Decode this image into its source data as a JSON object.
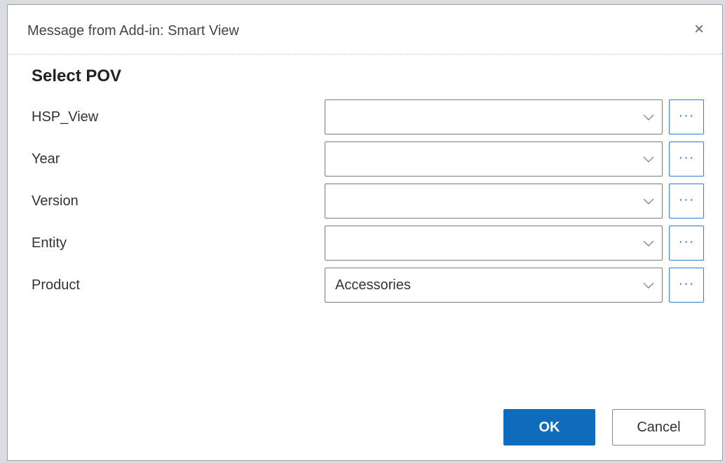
{
  "window": {
    "title": "Message from Add-in: Smart View",
    "close_glyph": "×"
  },
  "heading": "Select POV",
  "pov_rows": [
    {
      "label": "HSP_View",
      "value": "",
      "browse_label": "···"
    },
    {
      "label": "Year",
      "value": "",
      "browse_label": "···"
    },
    {
      "label": "Version",
      "value": "",
      "browse_label": "···"
    },
    {
      "label": "Entity",
      "value": "",
      "browse_label": "···"
    },
    {
      "label": "Product",
      "value": "Accessories",
      "browse_label": "···"
    }
  ],
  "buttons": {
    "ok": "OK",
    "cancel": "Cancel"
  },
  "icons": {
    "close": "close-icon",
    "dropdown": "chevron-down-icon",
    "browse": "ellipsis-icon"
  },
  "colors": {
    "primary": "#0f6cbd",
    "accent_border": "#2b7cd3"
  }
}
